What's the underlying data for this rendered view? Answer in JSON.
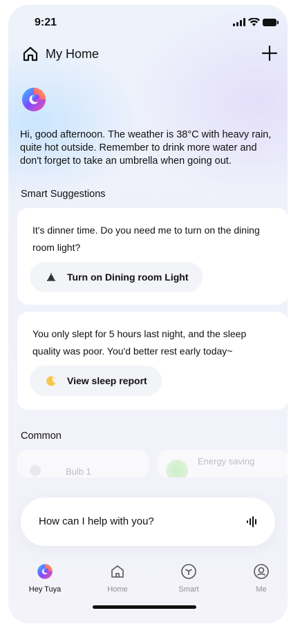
{
  "status_bar": {
    "time": "9:21"
  },
  "header": {
    "title": "My Home",
    "add_icon": "plus-icon",
    "home_icon": "home-icon"
  },
  "assistant": {
    "greeting": "Hi, good afternoon. The weather is 38°C with heavy rain, quite hot outside. Remember to drink more water and don't forget to take an umbrella when going out."
  },
  "suggestions": {
    "title": "Smart Suggestions",
    "items": [
      {
        "text": "It's dinner time. Do you need me to turn on the dining room light?",
        "action": "Turn on Dining room Light",
        "icon": "lamp-icon"
      },
      {
        "text": "You only slept for 5 hours last night, and the sleep quality was poor. You'd better rest early today~",
        "action": "View sleep report",
        "icon": "moon-icon"
      }
    ]
  },
  "common": {
    "title": "Common",
    "items": [
      {
        "label": "Bulb 1"
      },
      {
        "label": "Energy saving"
      }
    ]
  },
  "ask": {
    "placeholder": "How can I help with you?",
    "icon": "voice-wave-icon"
  },
  "tabs": [
    {
      "label": "Hey Tuya",
      "icon": "tuya-logo-icon",
      "active": true
    },
    {
      "label": "Home",
      "icon": "home-icon",
      "active": false
    },
    {
      "label": "Smart",
      "icon": "smart-cube-icon",
      "active": false
    },
    {
      "label": "Me",
      "icon": "user-icon",
      "active": false
    }
  ],
  "colors": {
    "background": "#f0f2fa",
    "card": "#ffffff",
    "pill": "#f3f4f8",
    "text": "#111111",
    "inactive_tab": "#8f8f99",
    "moon": "#f6c64b"
  }
}
